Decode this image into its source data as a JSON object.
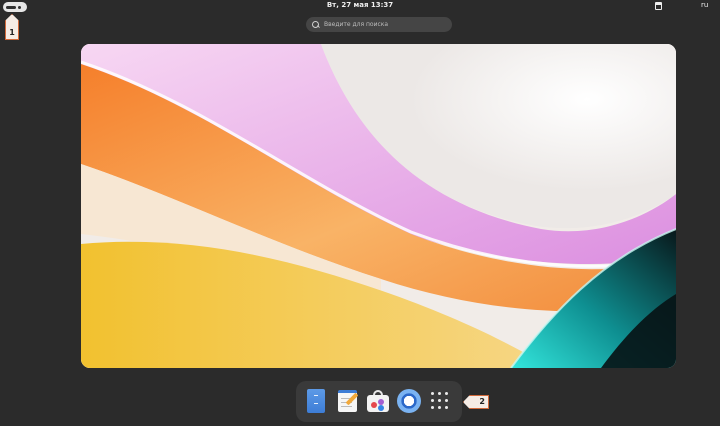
{
  "topbar": {
    "clock": "Вт, 27 мая  13:37",
    "language": "ru",
    "activities_icon": "activities-pill-icon",
    "tray_icon": "window-icon"
  },
  "search": {
    "placeholder": "Введите для поиска",
    "value": ""
  },
  "workspace": {
    "wallpaper_colors": [
      "#f7a04a",
      "#ef7b2e",
      "#f4c94a",
      "#e9a6e8",
      "#18c7c2",
      "#0b1a1c",
      "#f3f0ee"
    ]
  },
  "dock": {
    "apps": [
      {
        "name": "Files",
        "icon": "files-icon"
      },
      {
        "name": "Text Editor",
        "icon": "text-editor-icon"
      },
      {
        "name": "Software",
        "icon": "software-store-icon"
      },
      {
        "name": "Browser",
        "icon": "browser-icon"
      },
      {
        "name": "Show Apps",
        "icon": "app-grid-icon"
      }
    ]
  },
  "markers": [
    "1",
    "2"
  ],
  "colors": {
    "background": "#2b2b2b",
    "dock": "#3a3a3a",
    "search": "#454545",
    "marker_border": "#d2693a"
  }
}
